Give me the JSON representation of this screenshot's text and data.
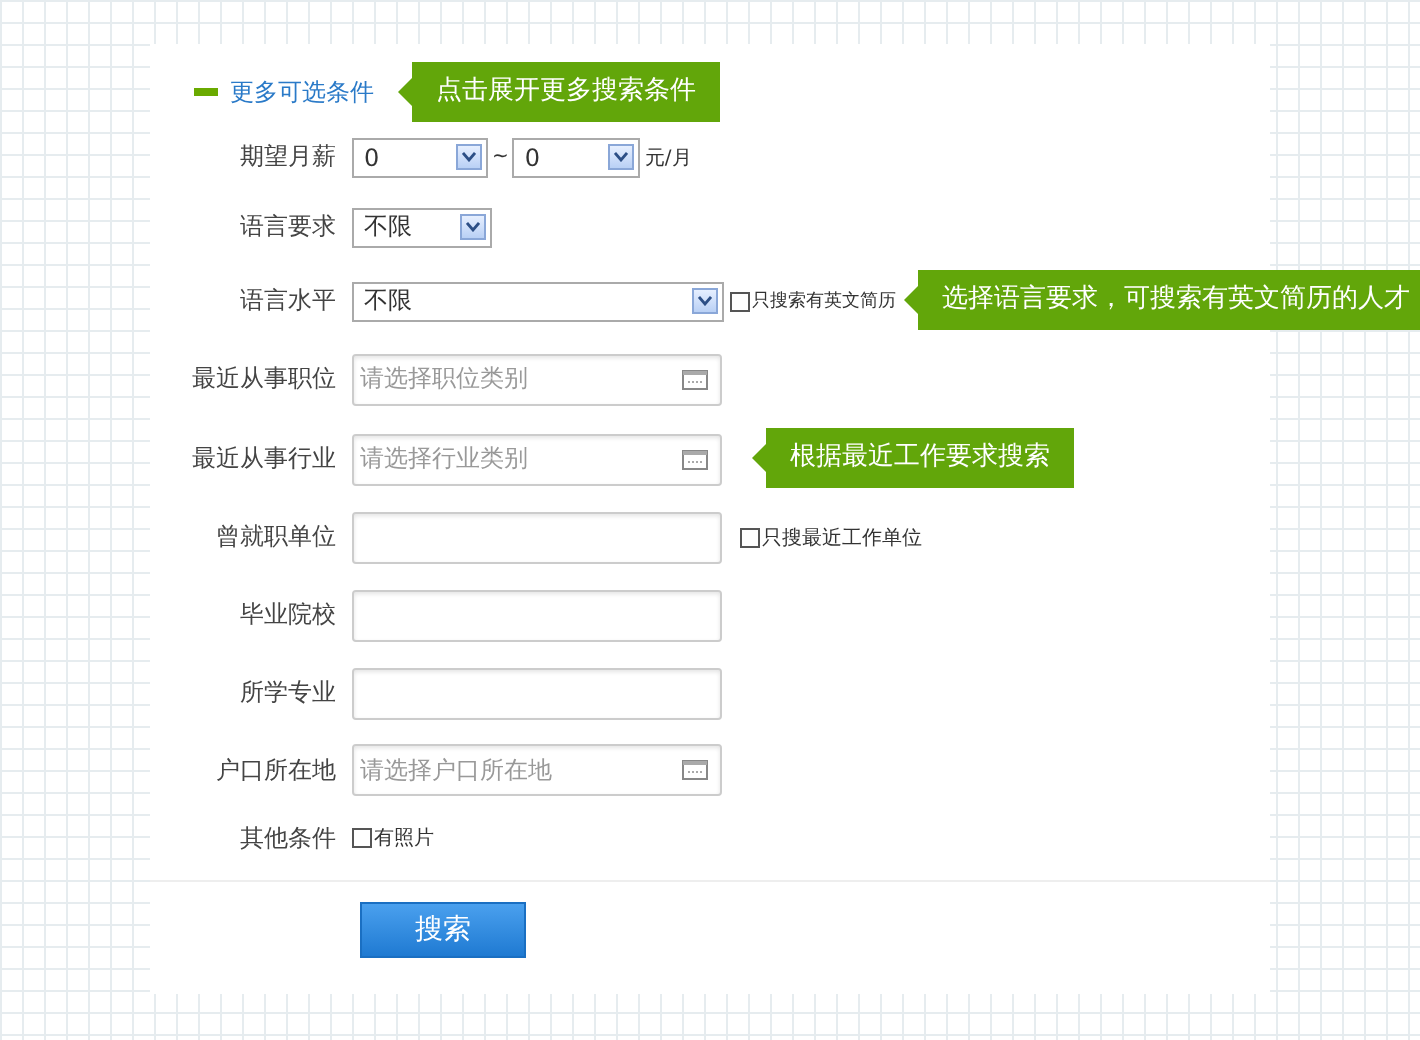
{
  "header": {
    "toggle_label": "更多可选条件",
    "expanded": true,
    "tip": "点击展开更多搜索条件"
  },
  "rows": [
    {
      "kind": "salary",
      "label": "期望月薪",
      "from": "0",
      "separator": "~",
      "to": "0",
      "unit": "元/月"
    },
    {
      "kind": "select",
      "label": "语言要求",
      "value": "不限"
    },
    {
      "kind": "select_wide",
      "label": "语言水平",
      "value": "不限",
      "option": {
        "label": "只搜索有英文简历",
        "checked": false
      },
      "tip": "选择语言要求，可搜索有英文简历的人才"
    },
    {
      "kind": "picker",
      "label": "最近从事职位",
      "placeholder": "请选择职位类别"
    },
    {
      "kind": "picker",
      "label": "最近从事行业",
      "placeholder": "请选择行业类别",
      "tip": "根据最近工作要求搜索"
    },
    {
      "kind": "text",
      "label": "曾就职单位",
      "option": {
        "label": "只搜最近工作单位",
        "checked": false
      }
    },
    {
      "kind": "text",
      "label": "毕业院校"
    },
    {
      "kind": "text",
      "label": "所学专业"
    },
    {
      "kind": "picker",
      "label": "户口所在地",
      "placeholder": "请选择户口所在地"
    },
    {
      "kind": "checkbox",
      "label": "其他条件",
      "option": {
        "label": "有照片",
        "checked": false
      }
    }
  ],
  "submit": "搜索"
}
